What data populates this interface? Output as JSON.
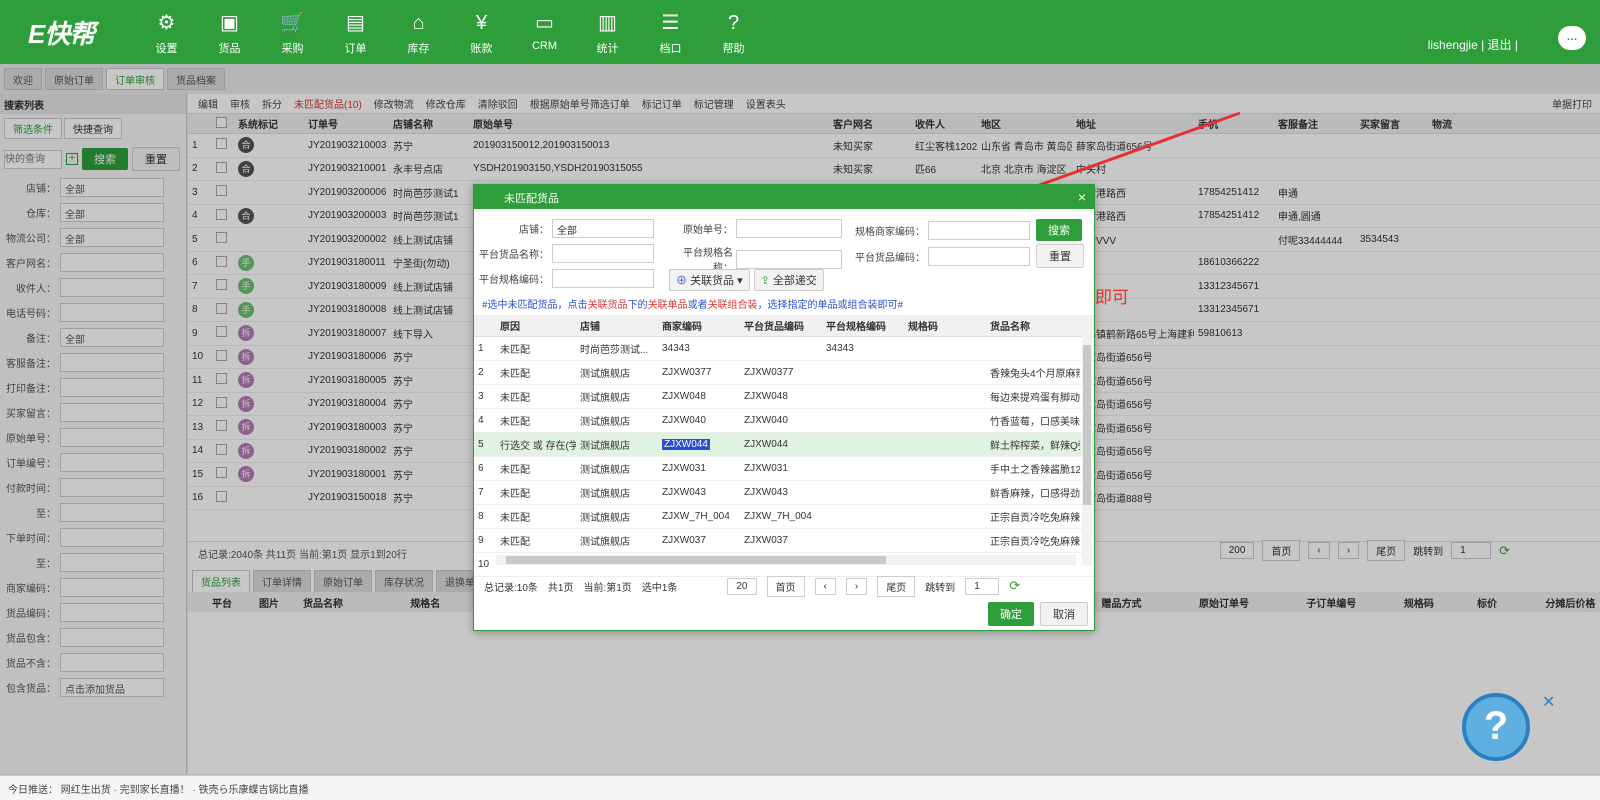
{
  "app": {
    "logo": "E快帮",
    "user": "lishengjie | 退出 |"
  },
  "nav": [
    "设置",
    "货品",
    "采购",
    "订单",
    "库存",
    "账款",
    "CRM",
    "统计",
    "档口",
    "帮助"
  ],
  "nav_icons": [
    "gear-icon",
    "package-icon",
    "cart-icon",
    "document-icon",
    "home-icon",
    "yen-icon",
    "inbox-icon",
    "chart-icon",
    "list-icon",
    "help-icon"
  ],
  "tabs": [
    "欢迎",
    "原始订单",
    "订单审核",
    "货品档案"
  ],
  "left": {
    "title": "搜索列表",
    "tab1": "筛选条件",
    "tab2": "快捷查询",
    "query_placeholder": "快的查询",
    "search_btn": "搜索",
    "reset_btn": "重置",
    "fields": [
      {
        "label": "店铺：",
        "value": "全部"
      },
      {
        "label": "仓库：",
        "value": "全部"
      },
      {
        "label": "物流公司：",
        "value": "全部"
      },
      {
        "label": "客户网名：",
        "value": ""
      },
      {
        "label": "收件人：",
        "value": ""
      },
      {
        "label": "电话号码：",
        "value": ""
      },
      {
        "label": "备注：",
        "value": "全部"
      },
      {
        "label": "客服备注：",
        "value": ""
      },
      {
        "label": "打印备注：",
        "value": ""
      },
      {
        "label": "买家留言：",
        "value": ""
      },
      {
        "label": "原始单号：",
        "value": ""
      },
      {
        "label": "订单编号：",
        "value": ""
      },
      {
        "label": "付款时间：",
        "value": ""
      },
      {
        "label": "至：",
        "value": ""
      },
      {
        "label": "下单时间：",
        "value": ""
      },
      {
        "label": "至：",
        "value": ""
      },
      {
        "label": "商家编码：",
        "value": ""
      },
      {
        "label": "货品编码：",
        "value": ""
      },
      {
        "label": "货品包含：",
        "value": ""
      },
      {
        "label": "货品不含：",
        "value": ""
      },
      {
        "label": "包含货品：",
        "value": "点击添加货品"
      }
    ]
  },
  "toolbar": [
    "编辑",
    "审核",
    "拆分",
    "未匹配货品(10)",
    "修改物流",
    "修改仓库",
    "清除驳回",
    "根据原始单号筛选订单",
    "标记订单",
    "标记管理",
    "设置表头"
  ],
  "toolbar_right": "单据打印",
  "grid": {
    "headers": [
      "系统标记",
      "订单号",
      "店铺名称",
      "原始单号",
      "客户网名",
      "收件人",
      "地区",
      "地址",
      "手机",
      "客服备注",
      "买家留言",
      "物流"
    ],
    "rows": [
      {
        "n": "1",
        "m": "合",
        "o": "JY201903210003",
        "s": "苏宁",
        "src": "201903150012,201903150013",
        "c": "未知买家",
        "r": "红尘客栈1202",
        "a": "山东省 青岛市 黄岛区",
        "ad": "薛家岛街道656号",
        "p": "",
        "cs": "",
        "bm": ""
      },
      {
        "n": "2",
        "m": "合",
        "o": "JY201903210001",
        "s": "永丰号点店",
        "src": "YSDH201903150,YSDH20190315055",
        "c": "未知买家",
        "r": "匹66",
        "a": "北京 北京市 海淀区",
        "ad": "中关村",
        "p": "",
        "cs": "",
        "bm": ""
      },
      {
        "n": "3",
        "m": "",
        "o": "JY201903200006",
        "s": "时尚芭莎测试1",
        "src": "",
        "c": "",
        "r": "",
        "a": "青岛市 黄岛区",
        "ad": "前湾港路西",
        "p": "17854251412",
        "cs": "申通",
        "bm": ""
      },
      {
        "n": "4",
        "m": "合",
        "o": "JY201903200003",
        "s": "时尚芭莎测试1",
        "src": "",
        "c": "",
        "r": "",
        "a": "青岛市 黄岛区",
        "ad": "前湾港路西",
        "p": "17854251412",
        "cs": "申通,圆通",
        "bm": ""
      },
      {
        "n": "5",
        "m": "",
        "o": "JY201903200002",
        "s": "线上测试店铺",
        "src": "",
        "c": "",
        "r": "",
        "a": "东莞市",
        "ad": "哈哈VVV",
        "p": "",
        "cs": "付呢33444444",
        "bm": "3534543"
      },
      {
        "n": "6",
        "m": "手",
        "o": "JY201903180011",
        "s": "宁圣街(勿动)",
        "src": "",
        "c": "",
        "r": "",
        "a": "",
        "ad": "",
        "p": "18610366222",
        "cs": "",
        "bm": ""
      },
      {
        "n": "7",
        "m": "手",
        "o": "JY201903180009",
        "s": "线上测试店铺",
        "src": "",
        "c": "",
        "r": "",
        "a": "",
        "ad": "yyh",
        "p": "13312345671",
        "cs": "",
        "bm": ""
      },
      {
        "n": "8",
        "m": "手",
        "o": "JY201903180008",
        "s": "线上测试店铺",
        "src": "",
        "c": "",
        "r": "",
        "a": "郑州市 惠山区",
        "ad": "yyh",
        "p": "13312345671",
        "cs": "",
        "bm": ""
      },
      {
        "n": "9",
        "m": "拆",
        "o": "JY201903180007",
        "s": "线下导入",
        "src": "",
        "c": "",
        "r": "",
        "a": "海市 青浦区",
        "ad": "白鹤镇鹤新路65号上海建利",
        "p": "59810613",
        "cs": "",
        "bm": ""
      },
      {
        "n": "10",
        "m": "拆",
        "o": "JY201903180006",
        "s": "苏宁",
        "src": "",
        "c": "",
        "r": "",
        "a": "青岛市 黄岛区",
        "ad": "薛家岛街道656号",
        "p": "",
        "cs": "",
        "bm": ""
      },
      {
        "n": "11",
        "m": "拆",
        "o": "JY201903180005",
        "s": "苏宁",
        "src": "",
        "c": "",
        "r": "",
        "a": "青岛市 黄岛区",
        "ad": "薛家岛街道656号",
        "p": "",
        "cs": "",
        "bm": ""
      },
      {
        "n": "12",
        "m": "拆",
        "o": "JY201903180004",
        "s": "苏宁",
        "src": "",
        "c": "",
        "r": "",
        "a": "青岛市 黄岛区",
        "ad": "薛家岛街道656号",
        "p": "",
        "cs": "",
        "bm": ""
      },
      {
        "n": "13",
        "m": "拆",
        "o": "JY201903180003",
        "s": "苏宁",
        "src": "",
        "c": "",
        "r": "",
        "a": "青岛市 黄岛区",
        "ad": "薛家岛街道656号",
        "p": "",
        "cs": "",
        "bm": ""
      },
      {
        "n": "14",
        "m": "拆",
        "o": "JY201903180002",
        "s": "苏宁",
        "src": "",
        "c": "",
        "r": "",
        "a": "青岛市 黄岛区",
        "ad": "薛家岛街道656号",
        "p": "",
        "cs": "",
        "bm": ""
      },
      {
        "n": "15",
        "m": "拆",
        "o": "JY201903180001",
        "s": "苏宁",
        "src": "",
        "c": "",
        "r": "",
        "a": "青岛市 黄岛区",
        "ad": "薛家岛街道656号",
        "p": "",
        "cs": "",
        "bm": ""
      },
      {
        "n": "16",
        "m": "",
        "o": "JY201903150018",
        "s": "苏宁",
        "src": "",
        "c": "",
        "r": "",
        "a": "青岛市 黄岛区",
        "ad": "薛家岛街道888号",
        "p": "",
        "cs": "",
        "bm": ""
      }
    ],
    "footer": "总记录:2040条   共11页   当前:第1页   显示1到20行",
    "page_size": "200",
    "first": "首页",
    "last": "尾页",
    "jump_label": "跳转到",
    "jump_value": "1"
  },
  "lower": {
    "tabs": [
      "货品列表",
      "订单详情",
      "原始订单",
      "库存状况",
      "退换单"
    ],
    "headers": [
      "平台",
      "图片",
      "货品名称",
      "规格名",
      "赠品方式",
      "原始订单号",
      "子订单编号",
      "规格码",
      "标价",
      "分摊后价格"
    ]
  },
  "dialog": {
    "title": "未匹配货品",
    "shop_label": "店铺：",
    "shop_value": "全部",
    "orig_label": "原始单号：",
    "sku_label": "规格商家编码：",
    "search_btn": "搜索",
    "pname_label": "平台货品名称：",
    "spec_label": "平台规格名称：",
    "pcode_label": "平台货品编码：",
    "reset_btn": "重置",
    "specno_label": "平台规格编码：",
    "link_btn": "关联货品",
    "deliver_btn": "全部递交",
    "hint_a": "#选中未匹配货品，点击",
    "hint_b": "关联货品",
    "hint_c": "下的",
    "hint_d": "关联单品",
    "hint_e": "或者",
    "hint_f": "关联组合装",
    "hint_g": "，选择指定的单品或组合装即可#",
    "headers": [
      "原因",
      "店铺",
      "商家编码",
      "平台货品编码",
      "平台规格编码",
      "规格码",
      "货品名称"
    ],
    "rows": [
      {
        "n": "1",
        "r": "未匹配",
        "s": "时尚芭莎测试...",
        "c": "34343",
        "pc": "",
        "ps": "34343",
        "sc": "",
        "nm": ""
      },
      {
        "n": "2",
        "r": "未匹配",
        "s": "测试旗舰店",
        "c": "ZJXW0377",
        "pc": "ZJXW0377",
        "ps": "",
        "sc": "",
        "nm": "香辣兔头4个月原麻辣"
      },
      {
        "n": "3",
        "r": "未匹配",
        "s": "测试旗舰店",
        "c": "ZJXW048",
        "pc": "ZJXW048",
        "ps": "",
        "sc": "",
        "nm": "每边来提鸡蛋有脚动"
      },
      {
        "n": "4",
        "r": "未匹配",
        "s": "测试旗舰店",
        "c": "ZJXW040",
        "pc": "ZJXW040",
        "ps": "",
        "sc": "",
        "nm": "竹香蓝莓，口感美味"
      },
      {
        "n": "5",
        "r": "行选交 或 存在(学)",
        "s": "测试旗舰店",
        "c": "ZJXW044",
        "pc": "ZJXW044",
        "ps": "",
        "sc": "",
        "nm": "鲜土榨榨菜，鲜辣Q弹"
      },
      {
        "n": "6",
        "r": "未匹配",
        "s": "测试旗舰店",
        "c": "ZJXW031",
        "pc": "ZJXW031",
        "ps": "",
        "sc": "",
        "nm": "手中土之香辣酱脆120"
      },
      {
        "n": "7",
        "r": "未匹配",
        "s": "测试旗舰店",
        "c": "ZJXW043",
        "pc": "ZJXW043",
        "ps": "",
        "sc": "",
        "nm": "鲜香麻辣，口感得劲"
      },
      {
        "n": "8",
        "r": "未匹配",
        "s": "测试旗舰店",
        "c": "ZJXW_7H_004",
        "pc": "ZJXW_7H_004",
        "ps": "",
        "sc": "",
        "nm": "正宗自贡冷吃兔麻辣"
      },
      {
        "n": "9",
        "r": "未匹配",
        "s": "测试旗舰店",
        "c": "ZJXW037",
        "pc": "ZJXW037",
        "ps": "",
        "sc": "",
        "nm": "正宗自贡冷吃兔麻辣"
      },
      {
        "n": "10",
        "r": "",
        "s": "",
        "c": "",
        "pc": "",
        "ps": "",
        "sc": "",
        "nm": ""
      }
    ],
    "footer_total": "总记录:10条",
    "footer_pages": "共1页",
    "footer_current": "当前:第1页",
    "footer_selected": "选中1条",
    "page_size": "20",
    "first": "首页",
    "last": "尾页",
    "jump_label": "跳转到",
    "jump_value": "1",
    "ok_btn": "确定",
    "cancel_btn": "取消"
  },
  "annotation": "关联好后点击全部递交即可",
  "bottom_bar": "今日推送：  网红生出货 · 完到家长直播！ · 铁壳ら乐康蝶吉锅比直播"
}
